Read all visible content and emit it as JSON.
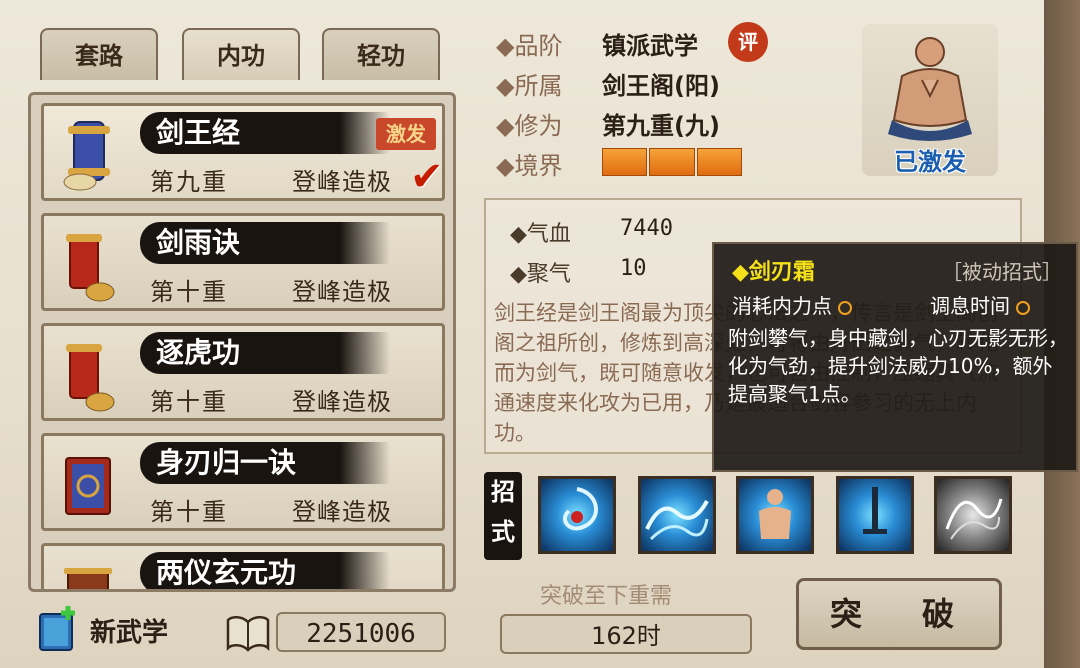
{
  "tabs": [
    "套路",
    "内功",
    "轻功"
  ],
  "skills": [
    {
      "name": "剑王经",
      "level": "第九重",
      "rank": "登峰造极",
      "badge": "激发",
      "selected": true
    },
    {
      "name": "剑雨诀",
      "level": "第十重",
      "rank": "登峰造极"
    },
    {
      "name": "逐虎功",
      "level": "第十重",
      "rank": "登峰造极"
    },
    {
      "name": "身刃归一诀",
      "level": "第十重",
      "rank": "登峰造极"
    },
    {
      "name": "两仪玄元功"
    }
  ],
  "bottom_left": {
    "new_label": "新武学",
    "currency": "2251006"
  },
  "info": {
    "rank_label": "◆品阶",
    "rank_value": "镇派武学",
    "rank_badge": "评",
    "sect_label": "◆所属",
    "sect_value": "剑王阁(阳)",
    "level_label": "◆修为",
    "level_value": "第九重(九)",
    "realm_label": "◆境界",
    "realm_filled": 3
  },
  "portrait": {
    "label": "已激发"
  },
  "stats": {
    "hp_label": "◆气血",
    "hp_value": "7440",
    "qi_label": "◆聚气",
    "qi_value": "10"
  },
  "description": "剑王经是剑王阁最为顶尖的心法之一，传言是剑王阁创阁之祖所创，修炼到高深处，可将由丹田之真气，转化而为剑气，既可随意收发，也可自由控制，压缩真气流通速度来化攻为已用，乃是最适合剑客参习的无上内功。",
  "zhaoshi_label": "招式",
  "break": {
    "need_label": "突破至下重需",
    "time": "162时",
    "button": "突　破"
  },
  "tooltip": {
    "title": "◆剑刃霜",
    "tag": "［被动招式］",
    "cost_label": "消耗内力点",
    "cd_label": "调息时间",
    "desc": "附剑攀气，身中藏剑，心刃无影无形，化为气劲，提升剑法威力10%，额外提高聚气1点。"
  }
}
